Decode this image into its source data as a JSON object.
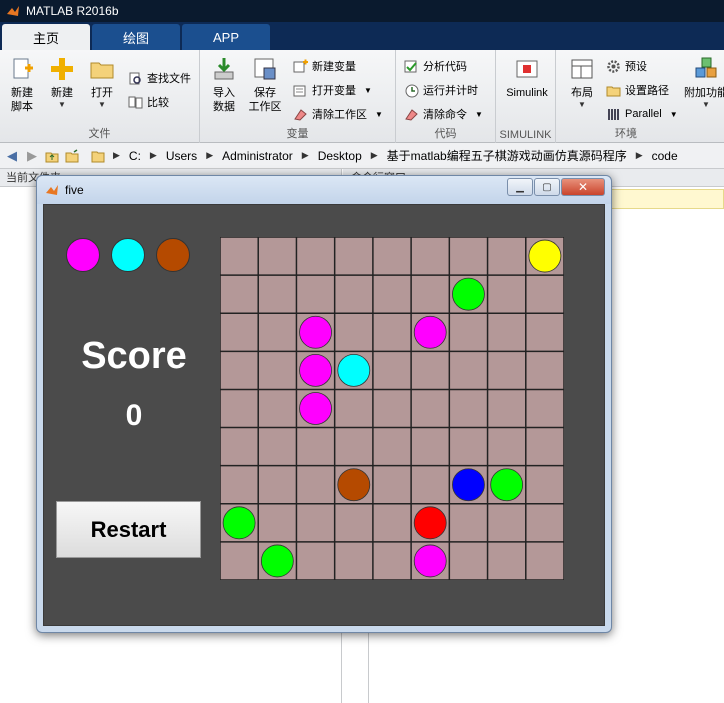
{
  "app": {
    "title": "MATLAB R2016b"
  },
  "ribbon_tabs": [
    {
      "label": "主页",
      "active": true
    },
    {
      "label": "绘图",
      "active": false
    },
    {
      "label": "APP",
      "active": false
    }
  ],
  "ribbon": {
    "file_group": {
      "label": "文件",
      "new_script": "新建\n脚本",
      "new": "新建",
      "open": "打开",
      "find_files": "查找文件",
      "compare": "比较"
    },
    "variable_group": {
      "label": "变量",
      "import_data": "导入\n数据",
      "save_workspace": "保存\n工作区",
      "new_variable": "新建变量",
      "open_variable": "打开变量",
      "clear_workspace": "清除工作区"
    },
    "code_group": {
      "label": "代码",
      "analyze_code": "分析代码",
      "run_and_time": "运行并计时",
      "clear_commands": "清除命令"
    },
    "simulink_group": {
      "label": "SIMULINK",
      "simulink": "Simulink"
    },
    "env_group": {
      "label": "环境",
      "layout": "布局",
      "preferences": "预设",
      "set_path": "设置路径",
      "parallel": "Parallel",
      "addons": "附加功能"
    }
  },
  "address": {
    "crumbs": [
      "C:",
      "Users",
      "Administrator",
      "Desktop",
      "基于matlab编程五子棋游戏动画仿真源码程序",
      "code"
    ]
  },
  "panels": {
    "current_folder": "当前文件夹",
    "command_window": "命令行窗口"
  },
  "figure": {
    "title": "five",
    "score_label": "Score",
    "score_value": "0",
    "restart_label": "Restart"
  },
  "colors": {
    "magenta": "#ff00ff",
    "cyan": "#00ffff",
    "brown": "#b54a00",
    "yellow": "#ffff00",
    "green": "#00ff00",
    "blue": "#0000ff",
    "red": "#ff0000",
    "board": "#b49898",
    "grid": "#222222"
  },
  "game": {
    "grid_size": 9,
    "next_balls": [
      "magenta",
      "cyan",
      "brown"
    ],
    "balls": [
      {
        "row": 0,
        "col": 8,
        "color": "yellow"
      },
      {
        "row": 1,
        "col": 6,
        "color": "green"
      },
      {
        "row": 2,
        "col": 2,
        "color": "magenta"
      },
      {
        "row": 2,
        "col": 5,
        "color": "magenta"
      },
      {
        "row": 3,
        "col": 2,
        "color": "magenta"
      },
      {
        "row": 3,
        "col": 3,
        "color": "cyan"
      },
      {
        "row": 4,
        "col": 2,
        "color": "magenta"
      },
      {
        "row": 6,
        "col": 3,
        "color": "brown"
      },
      {
        "row": 6,
        "col": 6,
        "color": "blue"
      },
      {
        "row": 6,
        "col": 7,
        "color": "green"
      },
      {
        "row": 7,
        "col": 0,
        "color": "green"
      },
      {
        "row": 7,
        "col": 5,
        "color": "red"
      },
      {
        "row": 8,
        "col": 1,
        "color": "green"
      },
      {
        "row": 8,
        "col": 5,
        "color": "magenta"
      }
    ]
  }
}
